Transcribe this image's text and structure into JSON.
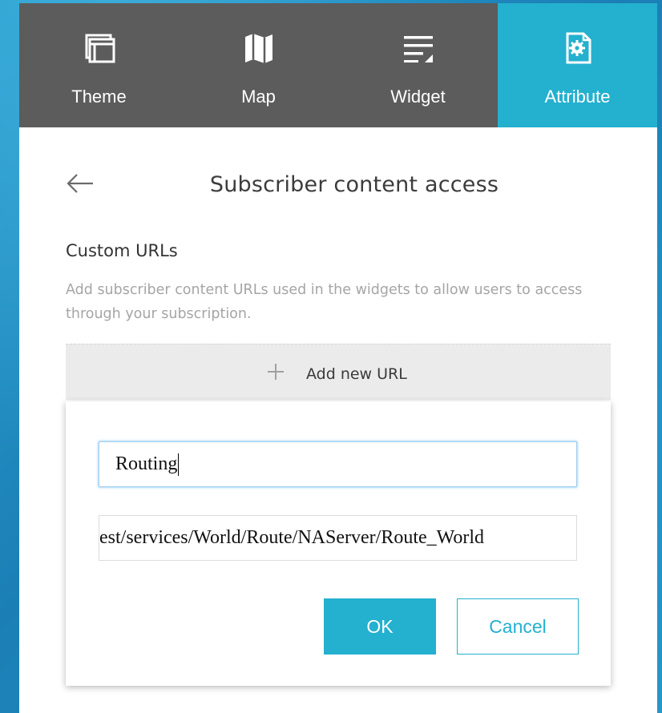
{
  "tabs": [
    {
      "label": "Theme",
      "icon": "theme-icon",
      "active": false
    },
    {
      "label": "Map",
      "icon": "map-icon",
      "active": false
    },
    {
      "label": "Widget",
      "icon": "widget-icon",
      "active": false
    },
    {
      "label": "Attribute",
      "icon": "attribute-icon",
      "active": true
    }
  ],
  "header": {
    "back_icon": "back-arrow-icon",
    "title": "Subscriber content access"
  },
  "section": {
    "title": "Custom URLs",
    "description": "Add subscriber content URLs used in the widgets to allow users to access through your subscription."
  },
  "add_bar": {
    "icon": "plus-icon",
    "label": "Add new URL"
  },
  "popup": {
    "name_value": "Routing",
    "url_value": "est/services/World/Route/NAServer/Route_World",
    "ok_label": "OK",
    "cancel_label": "Cancel"
  },
  "colors": {
    "accent": "#24b0cf",
    "tabbar": "#5c5c5c",
    "text": "#333333",
    "muted": "#a5a5a5"
  }
}
